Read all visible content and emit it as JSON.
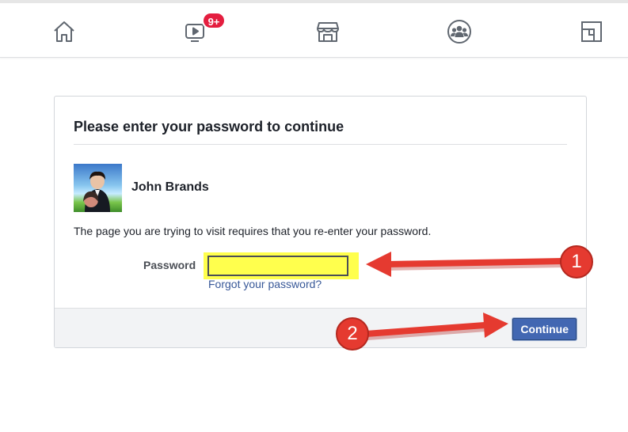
{
  "nav": {
    "items": [
      {
        "icon": "home-icon"
      },
      {
        "icon": "watch-icon",
        "badge": "9+"
      },
      {
        "icon": "marketplace-icon"
      },
      {
        "icon": "groups-icon"
      },
      {
        "icon": "gaming-icon"
      }
    ]
  },
  "dialog": {
    "title": "Please enter your password to continue",
    "user_name": "John Brands",
    "message": "The page you are trying to visit requires that you re-enter your password.",
    "password_label": "Password",
    "password_value": "",
    "forgot_link": "Forgot your password?",
    "continue_label": "Continue"
  },
  "annotations": {
    "step1": "1",
    "step2": "2",
    "color": "#e53a30",
    "highlight_color": "#ffff4d"
  },
  "colors": {
    "brand_blue": "#4267b2",
    "link_blue": "#385898",
    "badge_red": "#e41e3f"
  }
}
